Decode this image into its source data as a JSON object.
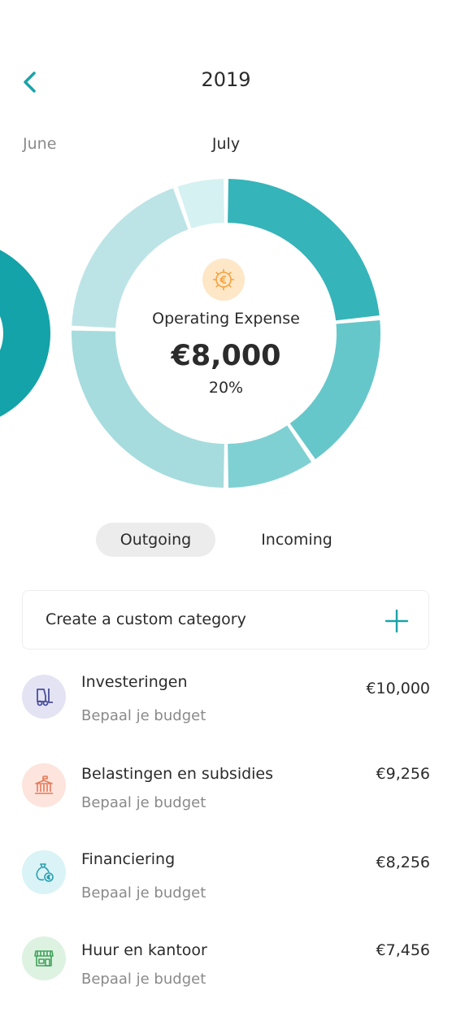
{
  "header": {
    "title": "2019",
    "back_icon": "chevron-left-icon"
  },
  "months": {
    "previous": "June",
    "current": "July"
  },
  "donut": {
    "selected": {
      "icon": "gear-euro-icon",
      "label": "Operating Expense",
      "amount": "€8,000",
      "percent": "20%"
    },
    "segments": [
      {
        "value": 22,
        "color": "#35b4b9"
      },
      {
        "value": 16,
        "color": "#66c7ca"
      },
      {
        "value": 9,
        "color": "#7fd0d2"
      },
      {
        "value": 24,
        "color": "#a6dcdd"
      },
      {
        "value": 18,
        "color": "#bce4e6"
      },
      {
        "value": 5,
        "color": "#d5f1f2"
      }
    ]
  },
  "tabs": {
    "outgoing": "Outgoing",
    "incoming": "Incoming",
    "active": "Outgoing"
  },
  "custom_category": {
    "label": "Create a custom category",
    "icon": "plus-icon"
  },
  "categories": [
    {
      "title": "Investeringen",
      "subtitle": "Bepaal je budget",
      "amount": "€10,000",
      "icon": "forklift-icon",
      "icon_bg": "#e3e3f3",
      "icon_color": "#4a4d9c"
    },
    {
      "title": "Belastingen en subsidies",
      "subtitle": "Bepaal je budget",
      "amount": "€9,256",
      "icon": "government-building-icon",
      "icon_bg": "#fde4dc",
      "icon_color": "#e47a5a"
    },
    {
      "title": "Financiering",
      "subtitle": "Bepaal je budget",
      "amount": "€8,256",
      "icon": "money-bag-icon",
      "icon_bg": "#d9f3f6",
      "icon_color": "#2a9fb0"
    },
    {
      "title": "Huur en kantoor",
      "subtitle": "Bepaal je budget",
      "amount": "€7,456",
      "icon": "storefront-icon",
      "icon_bg": "#ddf2e1",
      "icon_color": "#3fa35a"
    }
  ],
  "colors": {
    "accent": "#35b4b9",
    "neighbor_chart": "#13a3a8"
  }
}
